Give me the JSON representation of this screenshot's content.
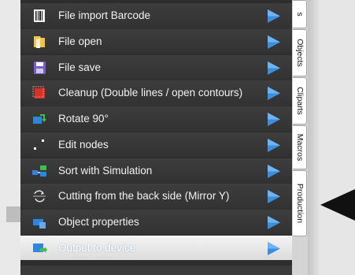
{
  "menu": {
    "items": [
      {
        "label": "File import Barcode",
        "icon": "barcode-icon"
      },
      {
        "label": "File open",
        "icon": "folder-open-icon"
      },
      {
        "label": "File save",
        "icon": "floppy-disk-icon"
      },
      {
        "label": "Cleanup (Double lines / open contours)",
        "icon": "cleanup-icon"
      },
      {
        "label": "Rotate 90°",
        "icon": "rotate-icon"
      },
      {
        "label": "Edit nodes",
        "icon": "edit-nodes-icon"
      },
      {
        "label": "Sort with Simulation",
        "icon": "sort-simulation-icon"
      },
      {
        "label": "Cutting from the back side (Mirror Y)",
        "icon": "mirror-y-icon"
      },
      {
        "label": "Object properties",
        "icon": "object-properties-icon"
      },
      {
        "label": "Output to device",
        "icon": "output-device-icon",
        "selected": true
      }
    ]
  },
  "tabs": [
    {
      "label": "s"
    },
    {
      "label": "Objects"
    },
    {
      "label": "Cliparts"
    },
    {
      "label": "Macros"
    },
    {
      "label": "Production"
    }
  ],
  "colors": {
    "panel_bg": "#2e2e2e",
    "item_text": "#f2f2f2",
    "arrow_blue": "#3a8fe0",
    "selected_bg": "#e8e8e8"
  }
}
